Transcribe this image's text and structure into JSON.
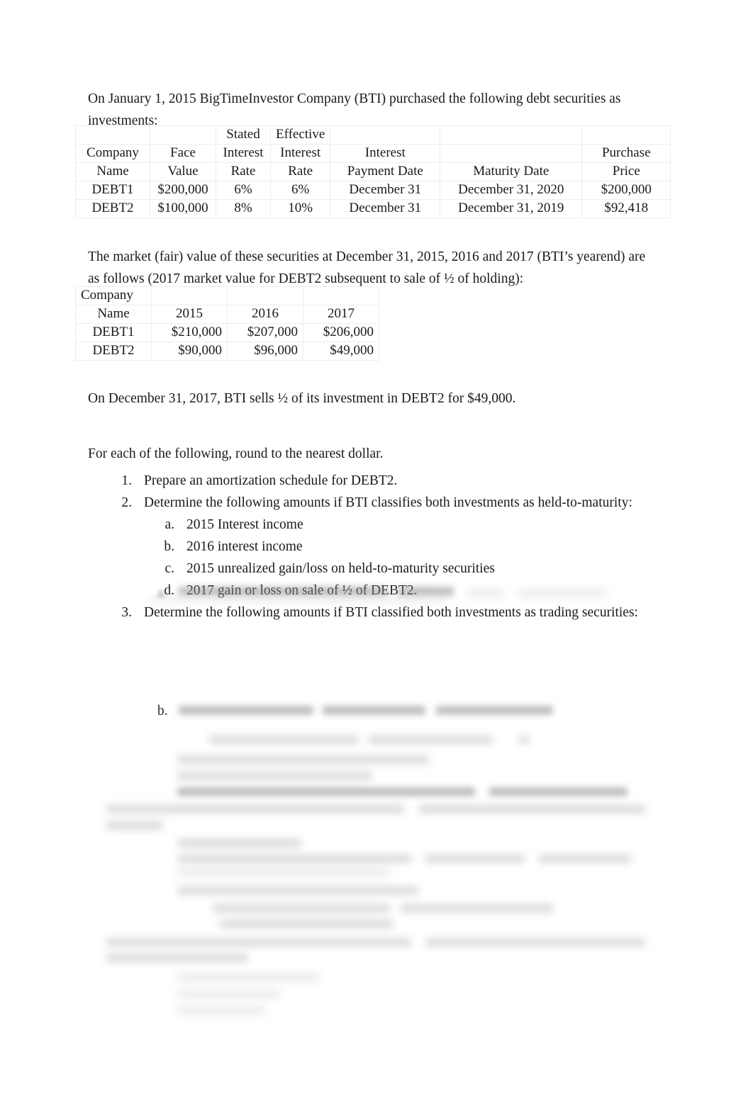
{
  "document": {
    "intro_paragraph": "On January 1, 2015 BigTimeInvestor Company (BTI) purchased the following debt securities as investments:",
    "market_paragraph": "The market (fair) value of these securities at December 31, 2015, 2016 and 2017 (BTI’s yearend) are as follows (2017 market value for DEBT2 subsequent to sale of ½ of holding):",
    "sale_paragraph": "On December 31, 2017, BTI sells ½ of its investment in DEBT2 for $49,000.",
    "rounding_instruction": "For each of the following, round to the nearest dollar."
  },
  "securities_table": {
    "headers": [
      {
        "line1": "",
        "line2": "Company",
        "line3": "Name"
      },
      {
        "line1": "",
        "line2": "Face",
        "line3": "Value"
      },
      {
        "line1": "Stated",
        "line2": "Interest",
        "line3": "Rate"
      },
      {
        "line1": "Effective",
        "line2": "Interest",
        "line3": "Rate"
      },
      {
        "line1": "",
        "line2": "Interest",
        "line3": "Payment Date"
      },
      {
        "line1": "",
        "line2": "",
        "line3": "Maturity Date"
      },
      {
        "line1": "",
        "line2": "Purchase",
        "line3": "Price"
      }
    ],
    "rows": [
      {
        "company_name": "DEBT1",
        "face_value": "$200,000",
        "stated_interest_rate": "6%",
        "effective_interest_rate": "6%",
        "interest_payment_date": "December 31",
        "maturity_date": "December 31, 2020",
        "purchase_price": "$200,000"
      },
      {
        "company_name": "DEBT2",
        "face_value": "$100,000",
        "stated_interest_rate": "8%",
        "effective_interest_rate": "10%",
        "interest_payment_date": "December 31",
        "maturity_date": "December 31, 2019",
        "purchase_price": "$92,418"
      }
    ]
  },
  "fair_value_table": {
    "headers": [
      {
        "line1": "Company",
        "line2": "Name"
      },
      {
        "line1": "",
        "line2": "2015"
      },
      {
        "line1": "",
        "line2": "2016"
      },
      {
        "line1": "",
        "line2": "2017"
      }
    ],
    "rows": [
      {
        "company_name": "DEBT1",
        "y2015": "$210,000",
        "y2016": "$207,000",
        "y2017": "$206,000"
      },
      {
        "company_name": "DEBT2",
        "y2015": "$90,000",
        "y2016": "$96,000",
        "y2017": "$49,000"
      }
    ]
  },
  "requirements": [
    {
      "marker": "1.",
      "level": 1,
      "text": "Prepare an amortization schedule for DEBT2."
    },
    {
      "marker": "2.",
      "level": 1,
      "text": "Determine the following amounts if BTI classifies both investments as held-to-maturity:"
    },
    {
      "marker": "a.",
      "level": 2,
      "text": "2015 Interest income"
    },
    {
      "marker": "b.",
      "level": 2,
      "text": "2016 interest income"
    },
    {
      "marker": "c.",
      "level": 2,
      "text": "2015 unrealized gain/loss on held-to-maturity securities"
    },
    {
      "marker": "d.",
      "level": 2,
      "text": "2017 gain or loss on sale of ½ of DEBT2."
    },
    {
      "marker": "3.",
      "level": 1,
      "text": "Determine the following amounts if BTI classified both investments as trading securities:"
    }
  ],
  "redacted_region": {
    "note": "Remaining answer content is blurred and illegible",
    "visible_markers": [
      {
        "marker": "b.",
        "level": 2
      }
    ]
  }
}
